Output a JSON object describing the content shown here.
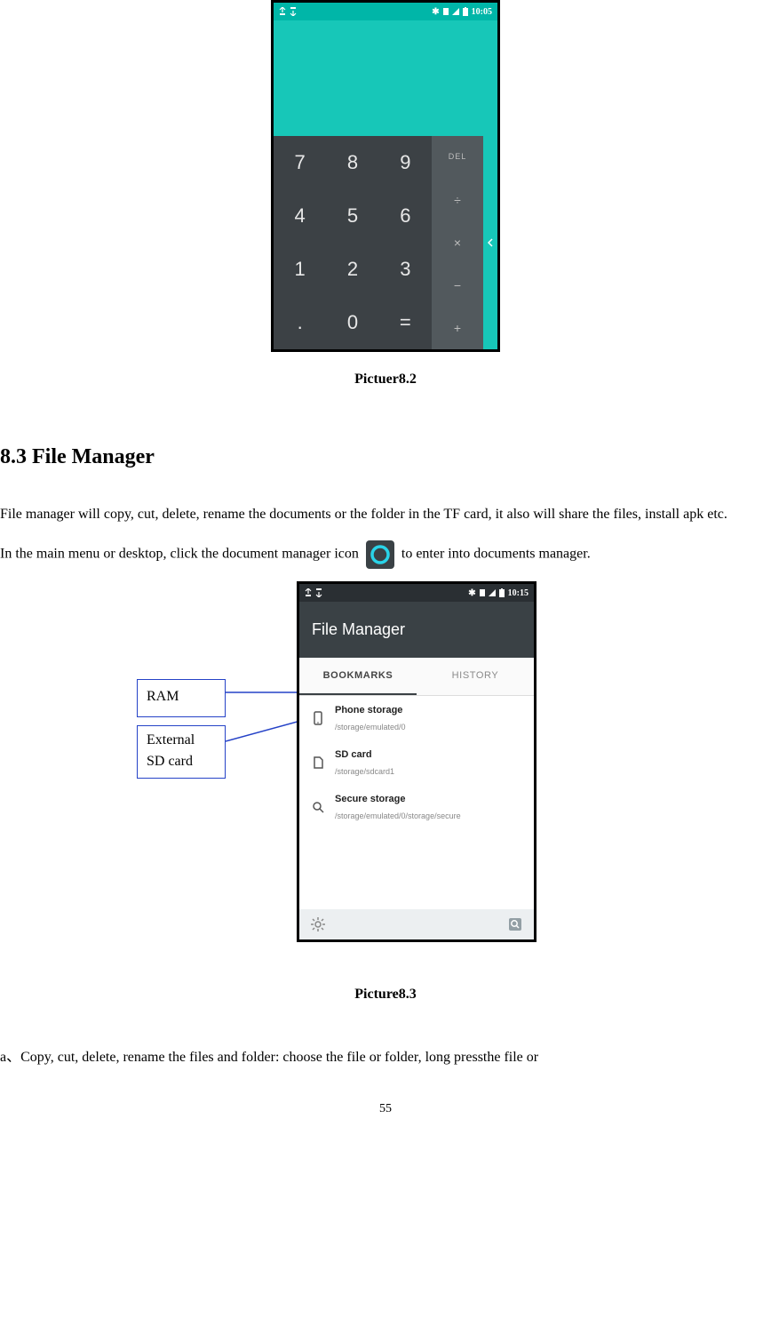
{
  "calc_screenshot": {
    "status": {
      "time": "10:05"
    },
    "keys": [
      "7",
      "8",
      "9",
      "4",
      "5",
      "6",
      "1",
      "2",
      "3",
      ".",
      "0",
      "="
    ],
    "ops": [
      "DEL",
      "÷",
      "×",
      "−",
      "+"
    ]
  },
  "caption1": "Pictuer8.2",
  "section_heading": "8.3 File Manager",
  "para1": "File manager will copy, cut, delete, rename the documents or the folder in the TF card, it also will share the files, install apk etc.",
  "para2a": "In the main menu or desktop, click the document manager icon",
  "para2b": "to enter into documents manager.",
  "fm": {
    "status_time": "10:15",
    "title": "File Manager",
    "tabs": {
      "bookmarks": "BOOKMARKS",
      "history": "HISTORY"
    },
    "items": [
      {
        "title": "Phone storage",
        "path": "/storage/emulated/0"
      },
      {
        "title": "SD card",
        "path": "/storage/sdcard1"
      },
      {
        "title": "Secure storage",
        "path": "/storage/emulated/0/storage/secure"
      }
    ]
  },
  "callouts": {
    "ram": "RAM",
    "sd1": "External",
    "sd2": "SD card"
  },
  "caption2": "Picture8.3",
  "para3": "a、Copy, cut, delete, rename the files and folder: choose the file or folder, long pressthe file or",
  "page_number": "55"
}
